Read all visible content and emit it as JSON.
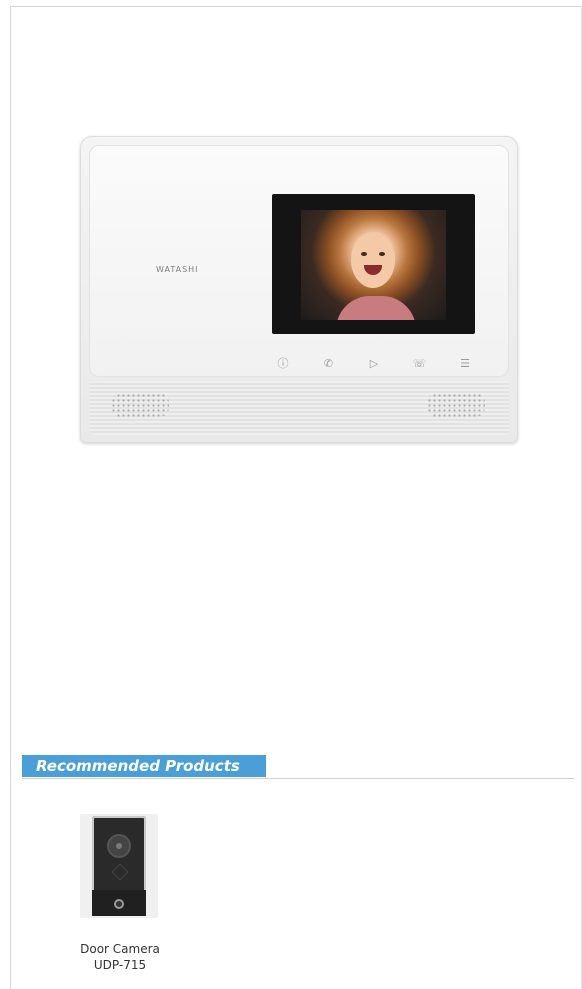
{
  "product_image": {
    "brand_text": "WATASHI",
    "buttons": [
      "info-icon",
      "answer-icon",
      "monitor-icon",
      "hangup-icon",
      "menu-icon"
    ]
  },
  "recommended": {
    "heading": "Recommended Products",
    "items": [
      {
        "name": "Door Camera",
        "model": "UDP-715"
      }
    ]
  },
  "colors": {
    "accent": "#4a9fd8",
    "text": "#333333",
    "divider": "#cfcfcf"
  }
}
